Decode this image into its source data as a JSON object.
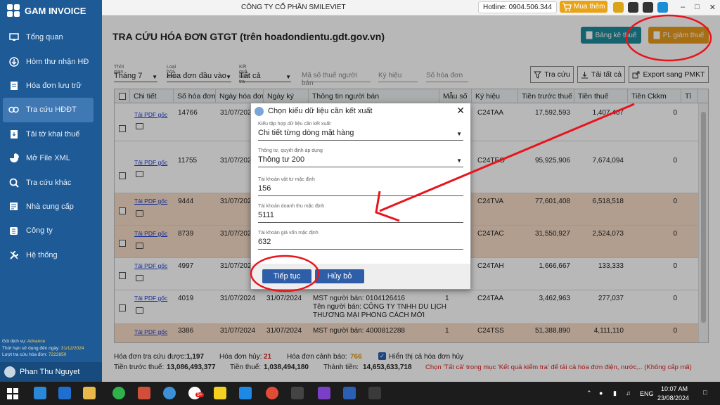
{
  "app": {
    "name": "GAM INVOICE",
    "company": "CÔNG TY CỔ PHẦN SMILEVIET",
    "hotline": "Hotline: 0904.506.344",
    "buy_label": "Mua thêm"
  },
  "sidebar": {
    "items": [
      {
        "label": "Tổng quan",
        "icon": "monitor-icon"
      },
      {
        "label": "Hòm thư nhận HĐ",
        "icon": "inbox-icon"
      },
      {
        "label": "Hóa đơn lưu trữ",
        "icon": "document-icon"
      },
      {
        "label": "Tra cứu HĐĐT",
        "icon": "link-icon"
      },
      {
        "label": "Tải tờ khai thuế",
        "icon": "file-download-icon"
      },
      {
        "label": "Mở File XML",
        "icon": "pie-icon"
      },
      {
        "label": "Tra cứu khác",
        "icon": "search-icon"
      },
      {
        "label": "Nhà cung cấp",
        "icon": "supplier-icon"
      },
      {
        "label": "Công ty",
        "icon": "company-icon"
      },
      {
        "label": "Hệ thống",
        "icon": "wrench-icon"
      }
    ],
    "service_label": "Gói dịch vụ:",
    "service_value": "Advance",
    "expiry_label": "Thời hạn sử dụng đến ngày:",
    "expiry_value": "31/12/2024",
    "lookup_label": "Lượt tra cứu hóa đơn:",
    "lookup_value": "7222850",
    "user": "Phan Thu Nguyet"
  },
  "header": {
    "title": "TRA CỨU HÓA ĐƠN GTGT (trên hoadondientu.gdt.gov.vn)",
    "btn_tax_list": "Bảng kê thuế",
    "btn_pl": "PL giảm thuế"
  },
  "filters": {
    "time_label": "Thời gian",
    "time_value": "Tháng 7",
    "type_label": "Loại hóa đơn",
    "type_value": "Hóa đơn đầu vào",
    "result_label": "Kết quả kiểm tra",
    "result_value": "Tất cả",
    "seller_tax_placeholder": "Mã số thuế người bán",
    "symbol_placeholder": "Ký hiệu",
    "number_placeholder": "Số hóa đơn",
    "btn_search": "Tra cứu",
    "btn_download_all": "Tải tất cả",
    "btn_export": "Export sang PMKT"
  },
  "table": {
    "columns": [
      "Chi tiết",
      "Số hóa đơn",
      "Ngày hóa đơn",
      "Ngày ký",
      "Thông tin người bán",
      "Mẫu số",
      "Ký hiệu",
      "Tiền trước thuế",
      "Tiền thuế",
      "Tiền Ckkm",
      "Tỉ"
    ],
    "link_label": "Tải PDF gốc",
    "rows": [
      {
        "number": "14766",
        "date": "31/07/2024",
        "sign": "",
        "seller": "",
        "form": "",
        "symbol": "C24TAA",
        "pre_tax": "17,592,593",
        "tax": "1,407,407",
        "ckkm": "0"
      },
      {
        "number": "11755",
        "date": "31/07/2024",
        "sign": "",
        "seller": "",
        "form": "",
        "symbol": "C24TEO",
        "pre_tax": "95,925,906",
        "tax": "7,674,094",
        "ckkm": "0"
      },
      {
        "number": "9444",
        "date": "31/07/2024",
        "sign": "",
        "seller": "",
        "form": "",
        "symbol": "C24TVA",
        "pre_tax": "77,601,408",
        "tax": "6,518,518",
        "ckkm": "0"
      },
      {
        "number": "8739",
        "date": "31/07/2024",
        "sign": "",
        "seller": "",
        "form": "",
        "symbol": "C24TAC",
        "pre_tax": "31,550,927",
        "tax": "2,524,073",
        "ckkm": "0"
      },
      {
        "number": "4997",
        "date": "31/07/2024",
        "sign": "",
        "seller": "",
        "form": "",
        "symbol": "C24TAH",
        "pre_tax": "1,666,667",
        "tax": "133,333",
        "ckkm": "0"
      },
      {
        "number": "4019",
        "date": "31/07/2024",
        "sign": "31/07/2024",
        "seller": "MST người bán: 0104126416",
        "seller2": "Tên người bán: CÔNG TY TNHH DU LỊCH",
        "seller3": "THƯƠNG MẠI PHONG CÁCH MỚI",
        "form": "1",
        "symbol": "C24TAA",
        "pre_tax": "3,462,963",
        "tax": "277,037",
        "ckkm": "0"
      },
      {
        "number": "3386",
        "date": "31/07/2024",
        "sign": "31/07/2024",
        "seller": "MST người bán: 4000812288",
        "form": "1",
        "symbol": "C24TSS",
        "pre_tax": "51,388,890",
        "tax": "4,111,110",
        "ckkm": "0"
      }
    ]
  },
  "dialog": {
    "title": "Chọn kiểu dữ liệu cần kết xuất",
    "f1_label": "Kiểu tập hợp dữ liệu cần kết xuất",
    "f1_value": "Chi tiết từng dòng mặt hàng",
    "f2_label": "Thông tư, quyết định áp dụng",
    "f2_value": "Thông tư 200",
    "f3_label": "Tài khoản vật tư mặc định",
    "f3_value": "156",
    "f4_label": "Tài khoản doanh thu mặc định",
    "f4_value": "5111",
    "f5_label": "Tài khoản giá vốn mặc định",
    "f5_value": "632",
    "btn_continue": "Tiếp tục",
    "btn_cancel": "Hủy bỏ"
  },
  "footer": {
    "found_label": "Hóa đơn tra cứu được:",
    "found_value": "1,197",
    "cancelled_label": "Hóa đơn hủy:",
    "cancelled_value": "21",
    "warning_label": "Hóa đơn cảnh báo:",
    "warning_value": "766",
    "show_all_label": "Hiển thị cả hóa đơn hủy",
    "pretax_label": "Tiền trước thuế:",
    "pretax_value": "13,086,493,377",
    "tax_label": "Tiền thuế:",
    "tax_value": "1,038,494,180",
    "total_label": "Thành tiền:",
    "total_value": "14,653,633,718",
    "hint": "Chọn 'Tất cả' trong mục 'Kết quả kiểm tra' để tải cả hóa đơn điện, nước,.. (Không cấp mã)"
  },
  "taskbar": {
    "lang": "ENG",
    "time": "10:07 AM",
    "date": "23/08/2024",
    "badge": "5+"
  },
  "colors": {
    "sidebar": "#1e5a96",
    "teal": "#1c8a9a",
    "orange": "#e89a1c",
    "dialog_btn": "#2f5ea8",
    "annotation": "#e8141c"
  }
}
